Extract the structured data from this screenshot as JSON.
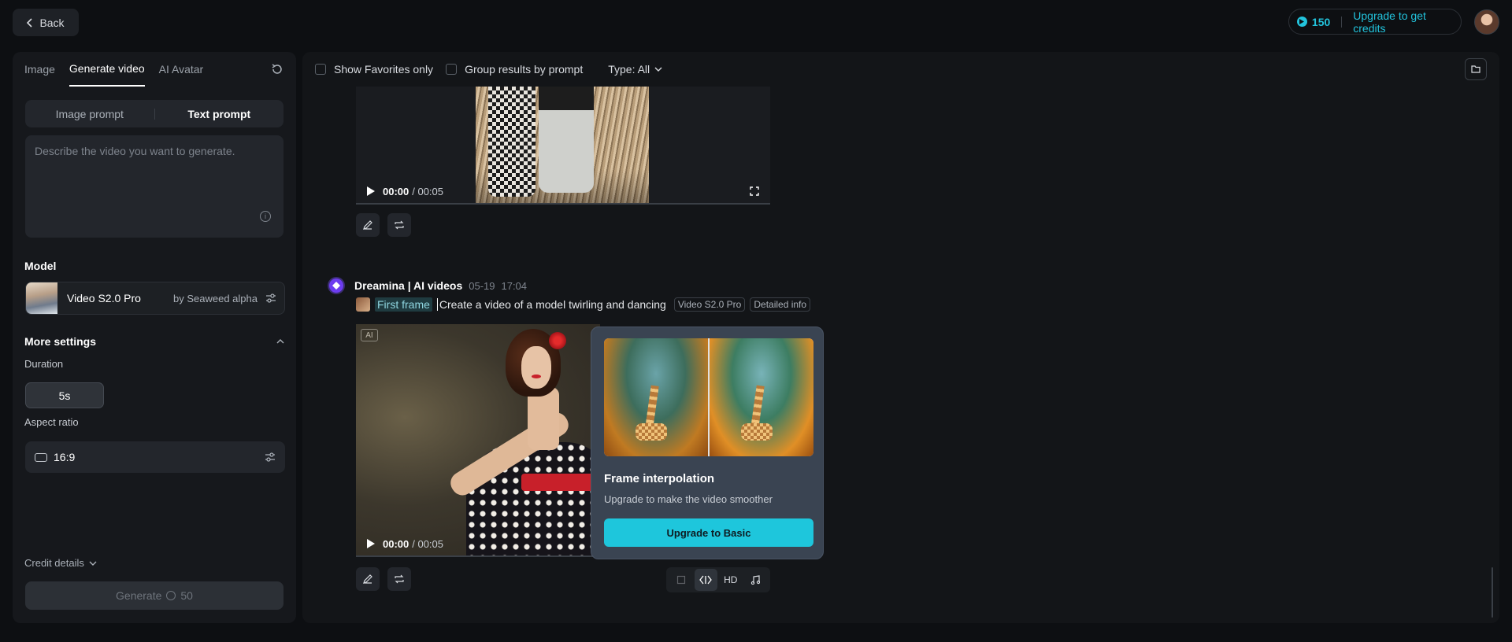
{
  "topbar": {
    "back_label": "Back",
    "credits": "150",
    "upgrade_label": "Upgrade to get credits"
  },
  "sidebar": {
    "tabs": [
      {
        "label": "Image"
      },
      {
        "label": "Generate video"
      },
      {
        "label": "AI Avatar"
      }
    ],
    "prompt_modes": [
      "Image prompt",
      "Text prompt"
    ],
    "prompt_placeholder": "Describe the video you want to generate.",
    "model_section_title": "Model",
    "model_name": "Video S2.0 Pro",
    "model_by": "by Seaweed alpha",
    "more_settings_title": "More settings",
    "duration_label": "Duration",
    "duration_value": "5s",
    "aspect_label": "Aspect ratio",
    "aspect_value": "16:9",
    "credit_details_label": "Credit details",
    "generate_label": "Generate",
    "generate_cost": "50"
  },
  "main": {
    "filters": {
      "favorites_label": "Show Favorites only",
      "group_label": "Group results by prompt",
      "type_label": "Type: All"
    },
    "video1": {
      "time_current": "00:00",
      "time_total": "/ 00:05"
    },
    "generation": {
      "brand": "Dreamina | AI videos",
      "date": "05-19",
      "time": "17:04",
      "first_frame_label": "First frame",
      "prompt_text": "Create a video of a model twirling and dancing",
      "tag_model": "Video S2.0 Pro",
      "tag_info": "Detailed info",
      "ai_badge": "AI",
      "time_current": "00:00",
      "time_total": "/ 00:05"
    },
    "popover": {
      "title": "Frame interpolation",
      "description": "Upgrade to make the video smoother",
      "cta_label": "Upgrade to Basic"
    },
    "tools": {
      "hd_label": "HD"
    }
  },
  "colors": {
    "accent": "#1ec6dc",
    "brand": "#6d3cf0"
  }
}
